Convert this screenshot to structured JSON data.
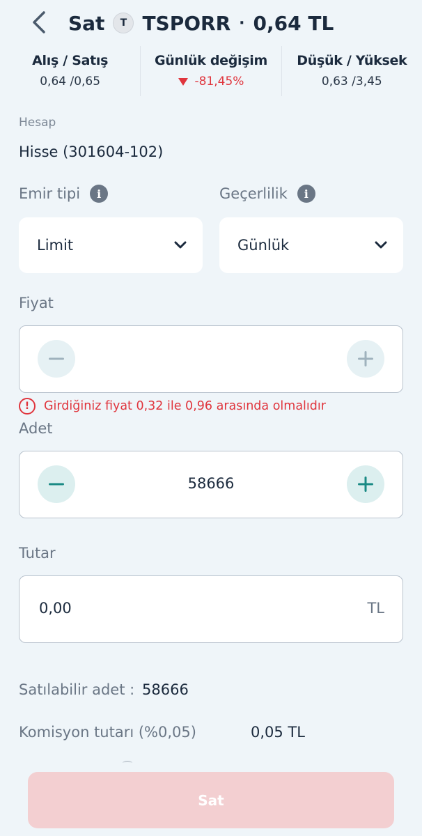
{
  "header": {
    "side": "Sat",
    "badge": "T",
    "symbol": "TSPORR",
    "separator": "·",
    "price": "0,64 TL"
  },
  "stats": [
    {
      "label": "Alış / Satış",
      "value": "0,64 /0,65"
    },
    {
      "label": "Günlük değişim",
      "value": "-81,45%"
    },
    {
      "label": "Düşük / Yüksek",
      "value": "0,63 /3,45"
    }
  ],
  "account": {
    "label": "Hesap",
    "value": "Hisse (301604-102)"
  },
  "order_type": {
    "label": "Emir tipi",
    "value": "Limit"
  },
  "validity": {
    "label": "Geçerlilik",
    "value": "Günlük"
  },
  "price": {
    "label": "Fiyat",
    "value": "",
    "error": "Girdiğiniz fiyat 0,32 ile 0,96 arasında olmalıdır"
  },
  "quantity": {
    "label": "Adet",
    "value": "58666"
  },
  "amount": {
    "label": "Tutar",
    "value": "0,00",
    "unit": "TL"
  },
  "summary": {
    "sellable_label": "Satılabilir adet :",
    "sellable_value": "58666",
    "commission_label": "Komisyon tutarı (%0,05)",
    "commission_value": "0,05 TL"
  },
  "sell_button": "Sat",
  "colors": {
    "background": "#eff5f9",
    "negative": "#e0353d",
    "accent": "#1a8a84",
    "sell_disabled": "#f3cfd1"
  }
}
